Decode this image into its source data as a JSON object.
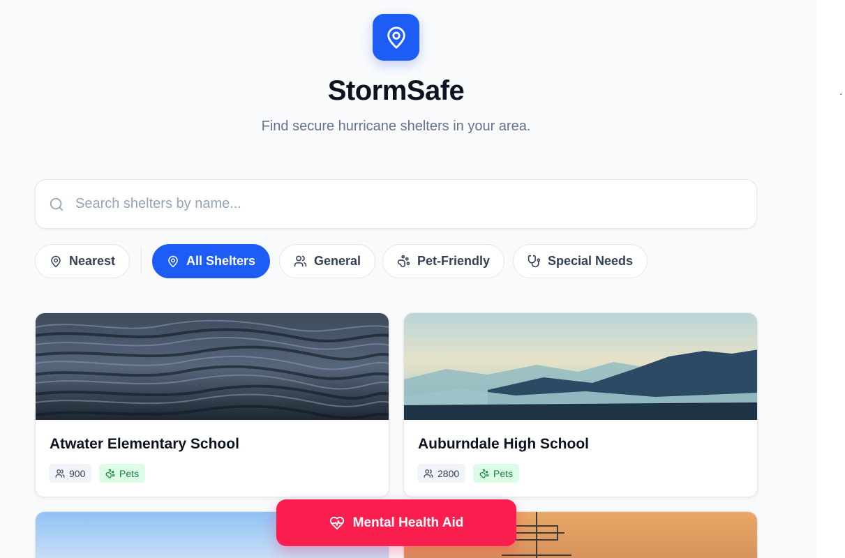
{
  "app": {
    "title": "StormSafe",
    "subtitle": "Find secure hurricane shelters in your area.",
    "logo_icon": "map-pin-icon",
    "accent_color": "#1d5cf5"
  },
  "search": {
    "placeholder": "Search shelters by name...",
    "value": "",
    "icon": "search-icon"
  },
  "filters": [
    {
      "label": "Nearest",
      "icon": "map-pin-icon",
      "active": false
    },
    {
      "label": "All Shelters",
      "icon": "map-pin-icon",
      "active": true
    },
    {
      "label": "General",
      "icon": "users-icon",
      "active": false
    },
    {
      "label": "Pet-Friendly",
      "icon": "paw-icon",
      "active": false
    },
    {
      "label": "Special Needs",
      "icon": "stethoscope-icon",
      "active": false
    }
  ],
  "shelters": [
    {
      "name": "Atwater Elementary School",
      "capacity": "900",
      "pets_label": "Pets",
      "image": "ocean-waves"
    },
    {
      "name": "Auburndale High School",
      "capacity": "2800",
      "pets_label": "Pets",
      "image": "misty-mountains"
    },
    {
      "name": "",
      "capacity": "",
      "pets_label": "",
      "image": "blue-sky"
    },
    {
      "name": "",
      "capacity": "",
      "pets_label": "",
      "image": "sunset-tower"
    }
  ],
  "fab": {
    "label": "Mental Health Aid",
    "icon": "heart-pulse-icon",
    "color": "#fb1f4f"
  }
}
